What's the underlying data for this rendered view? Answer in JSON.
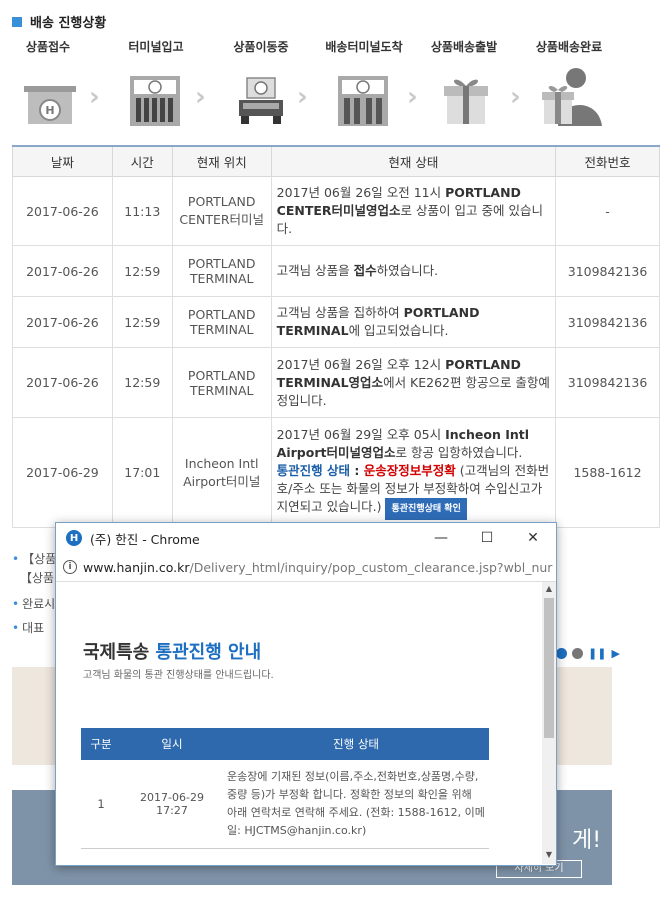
{
  "section_title": "배송 진행상황",
  "steps": [
    "상품접수",
    "터미널입고",
    "상품이동중",
    "배송터미널도착",
    "상품배송출발",
    "상품배송완료"
  ],
  "table": {
    "headers": [
      "날짜",
      "시간",
      "현재 위치",
      "현재 상태",
      "전화번호"
    ],
    "rows": [
      {
        "date": "2017-06-26",
        "time": "11:13",
        "location": "PORTLAND CENTER터미널",
        "status": {
          "pre": "2017년 06월 26일 오전 11시 ",
          "bold": "PORTLAND CENTER터미널영업소",
          "post": "로 상품이 입고 중에 있습니다."
        },
        "phone": "-"
      },
      {
        "date": "2017-06-26",
        "time": "12:59",
        "location": "PORTLAND TERMINAL",
        "status": {
          "pre": "고객님 상품을 ",
          "bold": "접수",
          "post": "하였습니다."
        },
        "phone": "3109842136"
      },
      {
        "date": "2017-06-26",
        "time": "12:59",
        "location": "PORTLAND TERMINAL",
        "status": {
          "pre": "고객님 상품을 집하하여 ",
          "bold": "PORTLAND TERMINAL",
          "post": "에 입고되었습니다."
        },
        "phone": "3109842136"
      },
      {
        "date": "2017-06-26",
        "time": "12:59",
        "location": "PORTLAND TERMINAL",
        "status": {
          "pre": "2017년 06월 26일 오후 12시 ",
          "bold": "PORTLAND TERMINAL영업소",
          "post": "에서 KE262편 항공으로 출항예정입니다."
        },
        "phone": "3109842136"
      },
      {
        "date": "2017-06-29",
        "time": "17:01",
        "location": "Incheon Intl Airport터미널",
        "status": {
          "pre": "2017년 06월 29일 오후 05시 ",
          "bold": "Incheon Intl Airport터미널영업소",
          "post": "로 항공 입항하였습니다.",
          "customs_label": "통관진행 상태",
          "customs_sep": " : ",
          "customs_value": "운송장정보부정확",
          "customs_note": " (고객님의 전화번호/주소 또는 화물의 정보가 부정확하여 수입신고가 지연되고 있습니다.) ",
          "button": "통관진행상태 확인"
        },
        "phone": "1588-1612"
      }
    ]
  },
  "notes": [
    "【상품",
    "【상품",
    "완료시",
    "대표 "
  ],
  "banner2_text": "게!",
  "banner2_button": "자세히 보기",
  "popup": {
    "window_title": "(주) 한진 - Chrome",
    "logo_letter": "H",
    "address_host": "www.hanjin.co.kr",
    "address_path": "/Delivery_html/inquiry/pop_custom_clearance.jsp?wbl_nur",
    "heading_prefix": "국제특송 ",
    "heading_highlight": "통관진행 안내",
    "subheading": "고객님 화물의 통관 진행상태를 안내드립니다.",
    "table_headers": [
      "구분",
      "일시",
      "진행 상태"
    ],
    "rows": [
      {
        "no": "1",
        "datetime": "2017-06-29 17:27",
        "status": "운송장에 기재된 정보(이름,주소,전화번호,상품명,수량,중량 등)가 부정확 합니다. 정확한 정보의 확인을 위해 아래 연락처로 연락해 주세요. (전화: 1588-1612, 이메일: HJCTMS@hanjin.co.kr)"
      }
    ]
  },
  "colors": {
    "accent": "#1d6fc2",
    "header_blue": "#2e68ad",
    "warning_red": "#d20000"
  }
}
